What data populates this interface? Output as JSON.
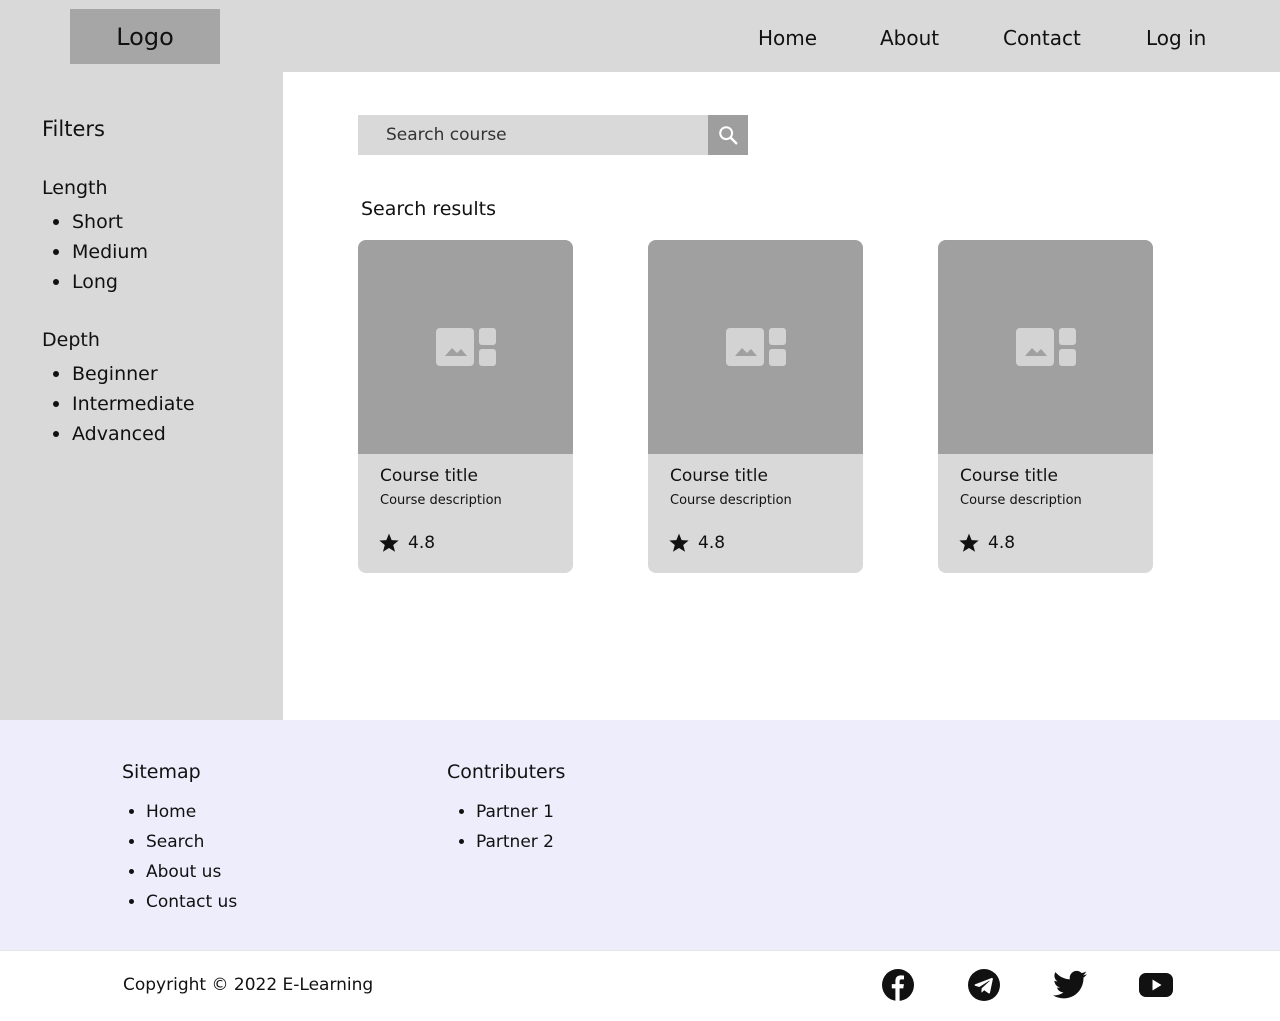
{
  "header": {
    "logo": "Logo",
    "nav": [
      "Home",
      "About",
      "Contact",
      "Log in"
    ]
  },
  "sidebar": {
    "title": "Filters",
    "groups": [
      {
        "title": "Length",
        "items": [
          "Short",
          "Medium",
          "Long"
        ]
      },
      {
        "title": "Depth",
        "items": [
          "Beginner",
          "Intermediate",
          "Advanced"
        ]
      }
    ]
  },
  "search": {
    "placeholder": "Search course",
    "icon": "search-icon"
  },
  "results": {
    "title": "Search results",
    "cards": [
      {
        "title": "Course title",
        "description": "Course description",
        "rating": "4.8"
      },
      {
        "title": "Course title",
        "description": "Course description",
        "rating": "4.8"
      },
      {
        "title": "Course title",
        "description": "Course description",
        "rating": "4.8"
      }
    ]
  },
  "footer": {
    "sitemap": {
      "title": "Sitemap",
      "items": [
        "Home",
        "Search",
        "About us",
        "Contact us"
      ]
    },
    "contributers": {
      "title": "Contributers",
      "items": [
        "Partner 1",
        "Partner 2"
      ]
    },
    "copyright": "Copyright © 2022 E-Learning",
    "social": [
      "facebook-icon",
      "telegram-icon",
      "twitter-icon",
      "youtube-icon"
    ]
  },
  "colors": {
    "header_bg": "#d9d9d9",
    "logo_bg": "#a6a6a6",
    "card_image_bg": "#a0a0a0",
    "footer_bg": "#eeedfc"
  }
}
